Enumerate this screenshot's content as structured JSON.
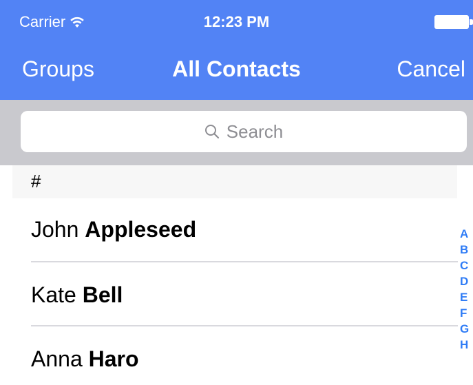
{
  "status_bar": {
    "carrier": "Carrier",
    "time": "12:23 PM",
    "wifi_icon": "wifi-icon",
    "battery_icon": "battery-icon"
  },
  "nav": {
    "left_button": "Groups",
    "title": "All Contacts",
    "right_button": "Cancel"
  },
  "search": {
    "placeholder": "Search",
    "icon": "search-icon"
  },
  "contacts": {
    "section_header": "#",
    "rows": [
      {
        "first": "John",
        "last": "Appleseed"
      },
      {
        "first": "Kate",
        "last": "Bell"
      },
      {
        "first": "Anna",
        "last": "Haro"
      }
    ]
  },
  "index": [
    "A",
    "B",
    "C",
    "D",
    "E",
    "F",
    "G",
    "H"
  ],
  "colors": {
    "nav_background": "#5283f5",
    "search_area_background": "#c9c9ce",
    "index_accent": "#2f7cf6"
  }
}
